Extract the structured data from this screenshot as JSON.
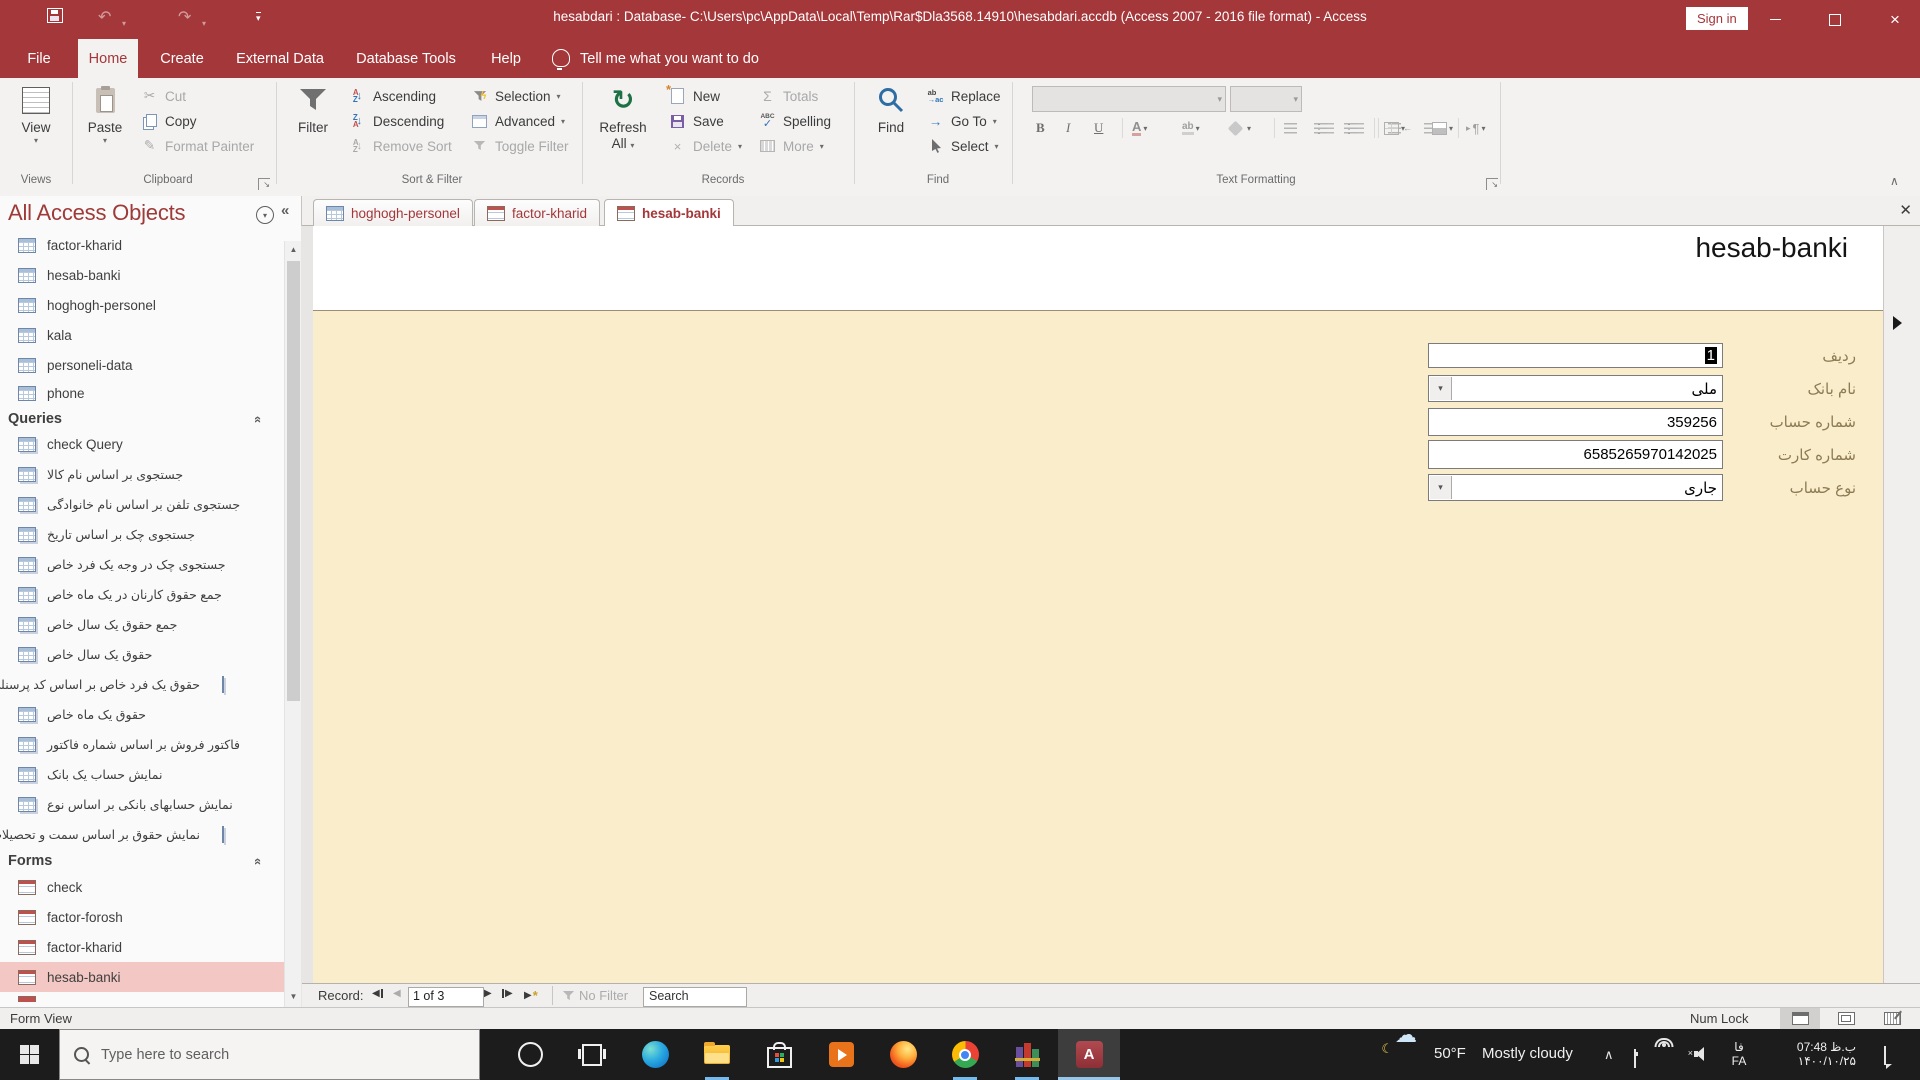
{
  "titlebar": {
    "title": "hesabdari : Database- C:\\Users\\pc\\AppData\\Local\\Temp\\Rar$Dla3568.14910\\hesabdari.accdb (Access 2007 - 2016 file format)  -  Access",
    "sign_in": "Sign in"
  },
  "ribbon": {
    "tabs": [
      {
        "label": "File"
      },
      {
        "label": "Home",
        "active": true
      },
      {
        "label": "Create"
      },
      {
        "label": "External Data"
      },
      {
        "label": "Database Tools"
      },
      {
        "label": "Help"
      }
    ],
    "tell_me": "Tell me what you want to do",
    "views": {
      "label": "Views",
      "view": "View"
    },
    "clipboard": {
      "label": "Clipboard",
      "paste": "Paste",
      "cut": "Cut",
      "copy": "Copy",
      "format_painter": "Format Painter"
    },
    "sort_filter": {
      "label": "Sort & Filter",
      "filter": "Filter",
      "ascending": "Ascending",
      "descending": "Descending",
      "remove_sort": "Remove Sort",
      "selection": "Selection",
      "advanced": "Advanced",
      "toggle_filter": "Toggle Filter"
    },
    "records": {
      "label": "Records",
      "refresh": "Refresh",
      "all": "All",
      "new": "New",
      "save": "Save",
      "delete": "Delete",
      "totals": "Totals",
      "spelling": "Spelling",
      "more": "More"
    },
    "find_group": {
      "label": "Find",
      "find": "Find",
      "replace": "Replace",
      "go_to": "Go To",
      "select": "Select"
    },
    "text_formatting": {
      "label": "Text Formatting"
    }
  },
  "nav_pane": {
    "title": "All Access Objects",
    "tables": [
      {
        "label": "factor-kharid"
      },
      {
        "label": "hesab-banki"
      },
      {
        "label": "hoghogh-personel"
      },
      {
        "label": "kala"
      },
      {
        "label": "personeli-data"
      },
      {
        "label": "phone"
      }
    ],
    "queries_header": "Queries",
    "queries": [
      {
        "label": "check Query"
      },
      {
        "label": "جستجوی بر اساس نام کالا"
      },
      {
        "label": "جستجوی تلفن بر اساس نام خانوادگی"
      },
      {
        "label": "جستجوی چک بر اساس تاریخ"
      },
      {
        "label": "جستجوی چک در وجه یک فرد خاص"
      },
      {
        "label": "جمع حقوق کارنان در یک ماه خاص"
      },
      {
        "label": "جمع حقوق یک سال خاص"
      },
      {
        "label": "حقوق یک سال خاص"
      },
      {
        "label": "حقوق یک فرد خاص بر اساس کد پرسنلی"
      },
      {
        "label": "حقوق یک ماه خاص"
      },
      {
        "label": "فاکتور فروش بر اساس شماره فاکتور"
      },
      {
        "label": "نمایش حساب یک بانک"
      },
      {
        "label": "نمایش حسابهای بانکی بر اساس نوع"
      },
      {
        "label": "نمایش حقوق بر اساس سمت و تحصیلات"
      }
    ],
    "forms_header": "Forms",
    "forms": [
      {
        "label": "check"
      },
      {
        "label": "factor-forosh"
      },
      {
        "label": "factor-kharid"
      },
      {
        "label": "hesab-banki",
        "selected": true
      }
    ]
  },
  "doc_tabs": [
    {
      "label": "hoghogh-personel",
      "icon": "table"
    },
    {
      "label": "factor-kharid",
      "icon": "form"
    },
    {
      "label": "hesab-banki",
      "icon": "form",
      "active": true
    }
  ],
  "form": {
    "title": "hesab-banki",
    "fields": [
      {
        "label": "ردیف",
        "value": "1",
        "type": "text",
        "selected": true
      },
      {
        "label": "نام بانک",
        "value": "ملی",
        "type": "combo"
      },
      {
        "label": "شماره حساب",
        "value": "359256",
        "type": "text"
      },
      {
        "label": "شماره کارت",
        "value": "6585265970142025",
        "type": "text"
      },
      {
        "label": "نوع حساب",
        "value": "جاری",
        "type": "combo"
      }
    ]
  },
  "record_nav": {
    "label": "Record:",
    "position": "1 of 3",
    "no_filter": "No Filter",
    "search_placeholder": "Search"
  },
  "status_bar": {
    "view": "Form View",
    "num_lock": "Num Lock"
  },
  "taskbar": {
    "search_placeholder": "Type here to search",
    "weather_temp": "50°F",
    "weather_desc": "Mostly cloudy",
    "language_native": "فا",
    "language_code": "FA",
    "time": "ب.ظ 07:48",
    "date": "۱۴۰۰/۱۰/۲۵"
  },
  "colors": {
    "accent": "#A4373A",
    "form_background": "#F9EDCB",
    "selection_pink": "#F3C7C3",
    "taskbar": "#1C1C1C"
  }
}
